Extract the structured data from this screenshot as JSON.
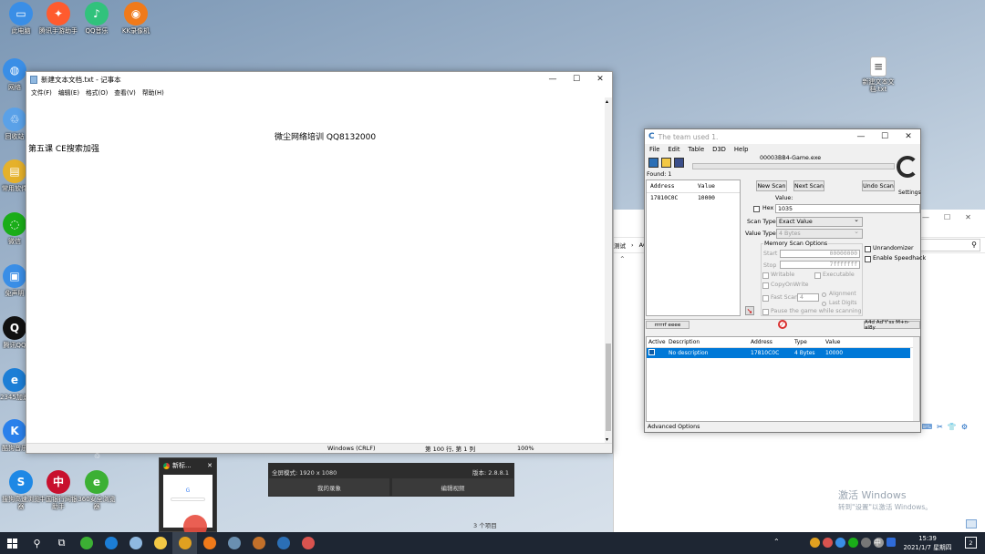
{
  "desktop": {
    "icons": [
      {
        "label": "此电脑",
        "color": "#3a8ee6",
        "glyph": "▭"
      },
      {
        "label": "腾讯手游助手",
        "color": "#ff5b2e",
        "glyph": "✦"
      },
      {
        "label": "QQ音乐",
        "color": "#31c27c",
        "glyph": "♪"
      },
      {
        "label": "KK录像机",
        "color": "#f07a1a",
        "glyph": "◉"
      },
      {
        "label": "网络",
        "color": "#3a8ee6",
        "glyph": "◍"
      },
      {
        "label": "回收站",
        "color": "#5aa1e8",
        "glyph": "♲"
      },
      {
        "label": "常用软件",
        "color": "#e5b12b",
        "glyph": "▤"
      },
      {
        "label": "微信",
        "color": "#1aad19",
        "glyph": "◌"
      },
      {
        "label": "免声明",
        "color": "#3a8ee6",
        "glyph": "▣"
      },
      {
        "label": "腾讯QQ",
        "color": "#111111",
        "glyph": "Q"
      },
      {
        "label": "2345加速浏览器",
        "color": "#1c7ed6",
        "glyph": "e"
      },
      {
        "label": "酷狗音乐",
        "color": "#2a80eb",
        "glyph": "K"
      },
      {
        "label": "搜狗高速浏览器",
        "color": "#1e88e5",
        "glyph": "S"
      },
      {
        "label": "中国银行网银助手",
        "color": "#c8102e",
        "glyph": "中"
      },
      {
        "label": "360安全浏览器",
        "color": "#3cb034",
        "glyph": "e"
      },
      {
        "label": "新建文本文档.txt",
        "color": "#ffffff",
        "glyph": "≡"
      }
    ],
    "watermark_title": "激活 Windows",
    "watermark_sub": "转到\"设置\"以激活 Windows。",
    "cursor_mark": "♲"
  },
  "notepad": {
    "title": "新建文本文档.txt - 记事本",
    "menu": [
      "文件(F)",
      "编辑(E)",
      "格式(O)",
      "查看(V)",
      "帮助(H)"
    ],
    "line1": "微尘网络培训 QQ8132000",
    "line2": "第五课 CE搜索加强",
    "status": {
      "encoding": "Windows (CRLF)",
      "position": "第 100 行, 第 1 列",
      "zoom": "100%"
    }
  },
  "cheat_engine": {
    "title": "The team used 1.",
    "menu": [
      "File",
      "Edit",
      "Table",
      "D3D",
      "Help"
    ],
    "process": "00003BB4-Game.exe",
    "found": "Found: 1",
    "results_headers": [
      "Address",
      "Value"
    ],
    "results": [
      {
        "address": "17810C0C",
        "value": "10000"
      }
    ],
    "new_scan": "New Scan",
    "next_scan": "Next Scan",
    "undo_scan": "Undo Scan",
    "settings": "Settings",
    "value_label": "Value:",
    "hex_label": "Hex",
    "value_input": "1035",
    "scan_type_label": "Scan Type",
    "scan_type": "Exact Value",
    "value_type_label": "Value Type",
    "value_type": "4 Bytes",
    "memory_options": "Memory Scan Options",
    "start_label": "Start",
    "start_value": "00000000",
    "stop_label": "Stop",
    "stop_value": "7fffffff",
    "writable": "Writable",
    "executable": "Executable",
    "copy_on_write": "CopyOnWrite",
    "fast_scan": "Fast Scan",
    "fast_scan_value": "4",
    "alignment": "Alignment",
    "last_digits": "Last Digits",
    "pause_game": "Pause the game while scanning",
    "unrandomizer": "Unrandomizer",
    "speedhack": "Enable Speedhack",
    "memory_view_btn": "rrrrrf eeee",
    "add_address_btn": "A4d Ad'Y'ss M+n-al8y",
    "table_headers": [
      "Active",
      "Description",
      "Address",
      "Type",
      "Value"
    ],
    "table_rows": [
      {
        "description": "No description",
        "address": "17810C0C",
        "type": "4 Bytes",
        "value": "10000"
      }
    ],
    "advanced": "Advanced Options"
  },
  "explorer": {
    "path_1": "测试",
    "path_2": "AG",
    "items_count": "3 个项目"
  },
  "chrome_preview": {
    "title": "新标..."
  },
  "kk_recorder": {
    "fullscreen": "全屏模式: 1920 x 1080",
    "version": "版本: 2.8.8.1",
    "my_recordings": "我的录象",
    "edit_video": "编辑视频"
  },
  "ime_bar": {
    "chars": [
      "中",
      "°,",
      "☺",
      "✎",
      "⌨",
      "✂",
      "👕",
      "⚙"
    ]
  },
  "taskbar": {
    "time": "15:39",
    "date": "2021/1/7 星期四",
    "ime": "中",
    "notification_count": "2",
    "pinned": [
      {
        "name": "search",
        "glyph": "⚲",
        "color": ""
      },
      {
        "name": "task-view",
        "glyph": "⧉",
        "color": ""
      },
      {
        "name": "360-browser",
        "glyph": "",
        "color": "#3cb034"
      },
      {
        "name": "ie",
        "glyph": "",
        "color": "#1c7ed6"
      },
      {
        "name": "notepad",
        "glyph": "",
        "color": "#8fb8e0"
      },
      {
        "name": "file-explorer",
        "glyph": "",
        "color": "#f3c845"
      },
      {
        "name": "chrome",
        "glyph": "",
        "color": "#e0a020"
      },
      {
        "name": "kk-recorder",
        "glyph": "",
        "color": "#f07a1a"
      },
      {
        "name": "calculator",
        "glyph": "",
        "color": "#6a8fb0"
      },
      {
        "name": "game",
        "glyph": "",
        "color": "#c2702a"
      },
      {
        "name": "cheat-engine",
        "glyph": "",
        "color": "#2b6fb6"
      },
      {
        "name": "app",
        "glyph": "",
        "color": "#d9534f"
      }
    ]
  }
}
